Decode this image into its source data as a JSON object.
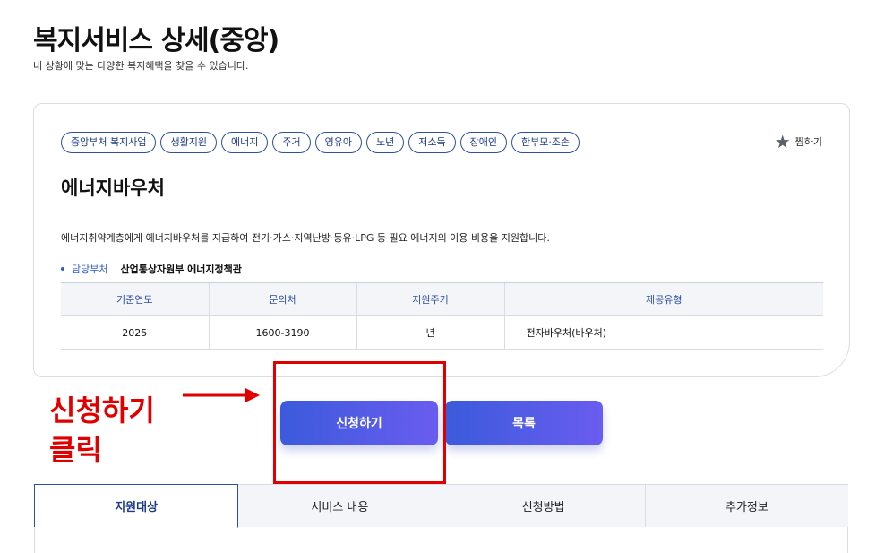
{
  "page": {
    "title": "복지서비스 상세(중앙)",
    "subtitle": "내 상황에 맞는 다양한 복지혜택을 찾을 수 있습니다."
  },
  "service": {
    "tags": [
      "중앙부처 복지사업",
      "생활지원",
      "에너지",
      "주거",
      "영유아",
      "노년",
      "저소득",
      "장애인",
      "한부모·조손"
    ],
    "bookmark_label": "찜하기",
    "bookmark_icon": "star-icon",
    "name": "에너지바우처",
    "description": "에너지취약계층에게 에너지바우처를 지급하여 전기·가스·지역난방·등유·LPG 등 필요 에너지의 이용 비용을 지원합니다.",
    "dept_label": "담당부처",
    "dept_value": "산업통상자원부 에너지정책관",
    "table": {
      "headers": [
        "기준연도",
        "문의처",
        "지원주기",
        "제공유형"
      ],
      "row": [
        "2025",
        "1600-3190",
        "년",
        "전자바우처(바우처)"
      ]
    }
  },
  "actions": {
    "apply_label": "신청하기",
    "list_label": "목록"
  },
  "annotation": {
    "text": "신청하기\n클릭",
    "color": "#e10000"
  },
  "tabs": [
    "지원대상",
    "서비스 내용",
    "신청방법",
    "추가정보"
  ],
  "colors": {
    "accent": "#2f4f9f",
    "button_gradient_start": "#3b5bdb",
    "button_gradient_end": "#6a5cf0"
  }
}
